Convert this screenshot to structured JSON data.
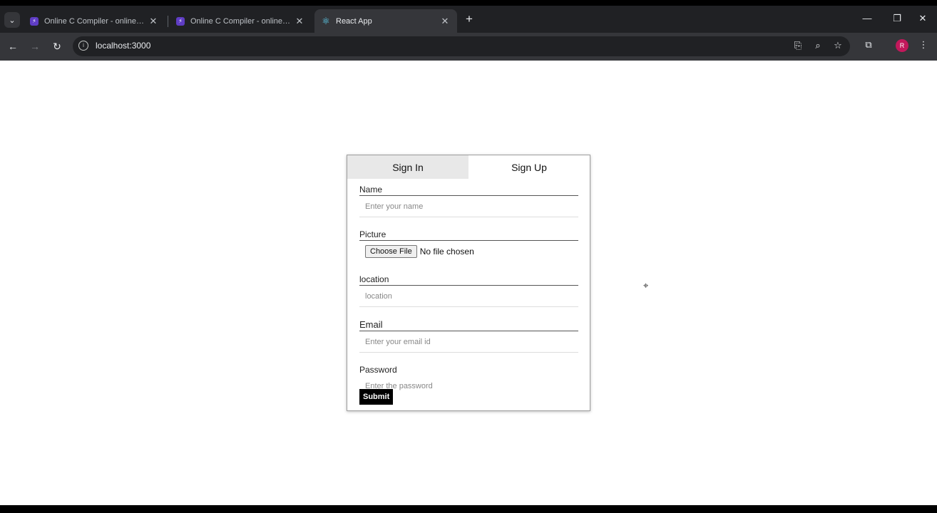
{
  "browser": {
    "tabs": [
      {
        "title": "Online C Compiler - online editor",
        "favicon": "bolt-icon",
        "close": "✕"
      },
      {
        "title": "Online C Compiler - online editor",
        "favicon": "bolt-icon",
        "close": "✕"
      },
      {
        "title": "React App",
        "favicon": "react-icon",
        "close": "✕"
      }
    ],
    "new_tab": "+",
    "url": "localhost:3000",
    "profile_initial": "R"
  },
  "form": {
    "tabs": {
      "signin": "Sign In",
      "signup": "Sign Up"
    },
    "name_label": "Name",
    "name_placeholder": "Enter your name",
    "picture_label": "Picture",
    "choose_file": "Choose File",
    "no_file": "No file chosen",
    "location_label": "location",
    "location_placeholder": "location",
    "email_label": "Email",
    "email_placeholder": "Enter your email id",
    "password_label": "Password",
    "password_placeholder": "Enter the password",
    "submit": "Submit"
  },
  "colors": {
    "tab_bar": "#202124",
    "toolbar": "#35363a",
    "inactive_tab": "#e8e8e8",
    "submit_bg": "#000000"
  }
}
